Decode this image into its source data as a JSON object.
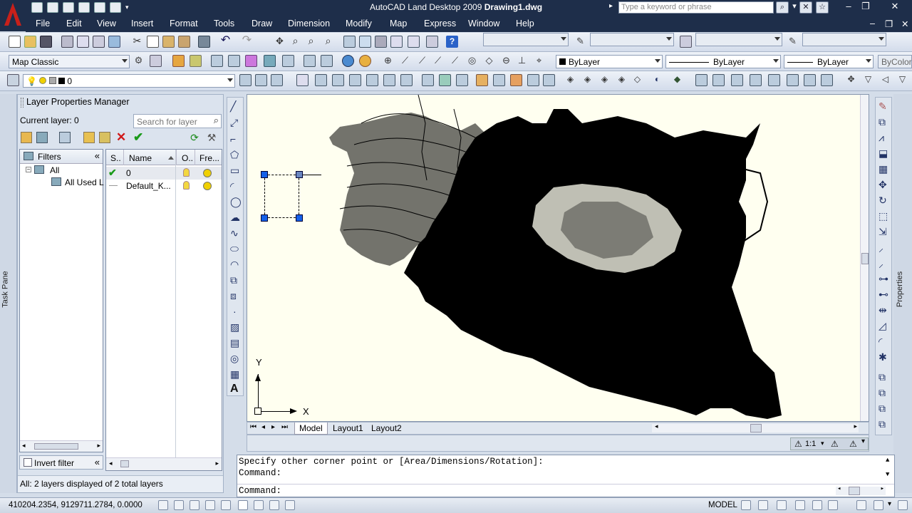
{
  "app": {
    "title_prefix": "AutoCAD Land Desktop 2009 ",
    "title_doc": "Drawing1.dwg",
    "search_placeholder": "Type a keyword or phrase"
  },
  "menu": [
    "File",
    "Edit",
    "View",
    "Insert",
    "Format",
    "Tools",
    "Draw",
    "Dimension",
    "Modify",
    "Map",
    "Express",
    "Window",
    "Help"
  ],
  "toolbar2": {
    "workspace": "Map Classic",
    "color": "ByLayer",
    "linetype": "ByLayer",
    "lineweight": "ByLayer",
    "plotstyle": "ByColor"
  },
  "toolbar3": {
    "layer_current": "0"
  },
  "layer_manager": {
    "title": "Layer Properties Manager",
    "current_layer": "Current layer: 0",
    "search_placeholder": "Search for layer",
    "filters_label": "Filters",
    "tree": [
      "All",
      "All Used L"
    ],
    "columns": [
      "S..",
      "Name",
      "O..",
      "Fre..."
    ],
    "layers": [
      {
        "name": "0",
        "current": true
      },
      {
        "name": "Default_K...",
        "current": false
      }
    ],
    "invert_filter": "Invert filter",
    "status": "All: 2 layers displayed of 2 total layers",
    "side_label": "Task Pane"
  },
  "drawing": {
    "ucs_x": "X",
    "ucs_y": "Y",
    "tabs": [
      "Model",
      "Layout1",
      "Layout2"
    ],
    "scale": "1:1"
  },
  "properties_label": "Properties",
  "command": {
    "line1": "Specify other corner point or [Area/Dimensions/Rotation]:",
    "line2": "Command:",
    "line3": "Command:"
  },
  "status": {
    "coords": "410204.2354, 9129711.2784, 0.0000",
    "model": "MODEL"
  },
  "colors": {
    "title_bg": "#1e2e4a",
    "canvas_bg": "#fffff0",
    "accent_red": "#c8201a"
  }
}
